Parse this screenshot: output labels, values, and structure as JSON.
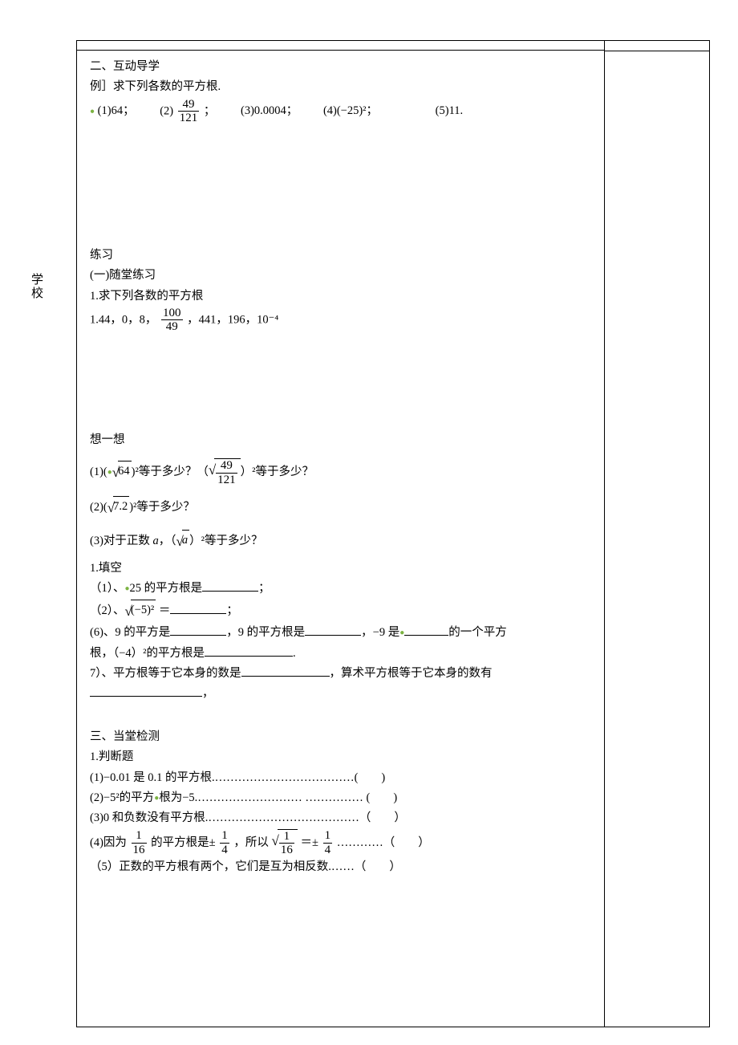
{
  "vertical_label": "学校",
  "s2": {
    "heading": "二、互动导学",
    "ex_label": "例］求下列各数的平方根.",
    "items": {
      "i1": "(1)64；",
      "i2_pre": "(2)",
      "i2_num": "49",
      "i2_den": "121",
      "i2_post": "；",
      "i3": "(3)0.0004；",
      "i4": "(4)(−25)²；",
      "i5": "(5)11."
    }
  },
  "practice": {
    "heading": "练习",
    "sub": "(一)随堂练习",
    "p1": "1.求下列各数的平方根",
    "list_pre": "1.44，0，8，",
    "list_num": "100",
    "list_den": "49",
    "list_post": "，441，196，10⁻⁴"
  },
  "think": {
    "heading": "想一想",
    "q1_a": "(1)(",
    "q1_rad1": "64",
    "q1_b": ")²等于多少？（",
    "q1_num": "49",
    "q1_den": "121",
    "q1_c": "）²等于多少？",
    "q2_a": "(2)(",
    "q2_rad": "7.2",
    "q2_b": ")²等于多少？",
    "q3_a": "(3)对于正数 ",
    "q3_var": "a",
    "q3_b": "，（",
    "q3_rad": "a",
    "q3_c": "）²等于多少？"
  },
  "fill": {
    "heading": "1.填空",
    "f1_a": "（1）、",
    "f1_b": "25 的平方根是",
    "f1_c": "；",
    "f2_a": "（2）、",
    "f2_rad": "(−5)²",
    "f2_b": " ＝",
    "f2_c": "；",
    "f6_a": "(6)、9 的平方是",
    "f6_b": "，9 的平方根是",
    "f6_c": "，−9 是",
    "f6_d": "的一个平方",
    "f6_e": "根，（−4）²的平方根是",
    "f6_f": ".",
    "f7_a": "7）、平方根等于它本身的数是",
    "f7_b": "，算术平方根等于它本身的数有",
    "f7_c": "，"
  },
  "s3": {
    "heading": "三、当堂检测",
    "sub": "1.判断题",
    "j1": "(1)−0.01 是 0.1 的平方根.………………………………(　　)",
    "j2": "(2)−5²的平方根为−5.……………………… …………… (　　)",
    "j3": "(3)0 和负数没有平方根.…………………………………（　　）",
    "j4_a": "(4)因为",
    "j4_num1": "1",
    "j4_den1": "16",
    "j4_b": "的平方根是±",
    "j4_num2": "1",
    "j4_den2": "4",
    "j4_c": "，所以",
    "j4_num3": "1",
    "j4_den3": "16",
    "j4_d": "＝±",
    "j4_num4": "1",
    "j4_den4": "4",
    "j4_e": "…………（　　）",
    "j5": "（5）正数的平方根有两个，它们是互为相反数.……（　　）"
  }
}
